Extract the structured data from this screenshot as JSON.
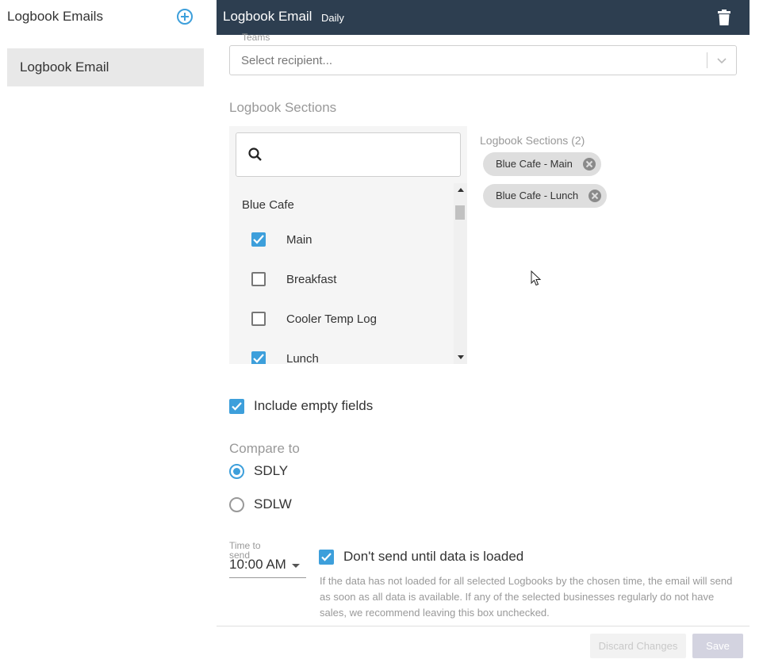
{
  "sidebar": {
    "header": "Logbook Emails",
    "add_icon": "plus-circle-icon",
    "items": [
      {
        "label": "Logbook Email",
        "selected": true
      }
    ]
  },
  "header": {
    "title": "Logbook Email",
    "subtitle": "Daily",
    "delete_icon": "trash-icon"
  },
  "teams": {
    "label": "Teams",
    "placeholder": "Select recipient..."
  },
  "sections": {
    "title": "Logbook Sections",
    "search_placeholder": "",
    "group": "Blue Cafe",
    "options": [
      {
        "label": "Main",
        "checked": true
      },
      {
        "label": "Breakfast",
        "checked": false
      },
      {
        "label": "Cooler Temp Log",
        "checked": false
      },
      {
        "label": "Lunch",
        "checked": true
      }
    ],
    "selected_title": "Logbook Sections (2)",
    "selected": [
      "Blue Cafe - Main",
      "Blue Cafe - Lunch"
    ]
  },
  "include_empty": {
    "label": "Include empty fields",
    "checked": true
  },
  "compare": {
    "title": "Compare to",
    "options": [
      {
        "label": "SDLY",
        "selected": true
      },
      {
        "label": "SDLW",
        "selected": false
      }
    ]
  },
  "time": {
    "label": "Time to send",
    "value": "10:00 AM"
  },
  "dont_send": {
    "label": "Don't send until data is loaded",
    "checked": true,
    "note": "If the data has not loaded for all selected Logbooks by the chosen time, the email will send as soon as all data is available. If any of the selected businesses regularly do not have sales, we recommend leaving this box unchecked."
  },
  "footer": {
    "discard_label": "Discard Changes",
    "save_label": "Save"
  },
  "colors": {
    "accent": "#3d9fdb",
    "topbar": "#2d3e50",
    "chip": "#dedede"
  }
}
